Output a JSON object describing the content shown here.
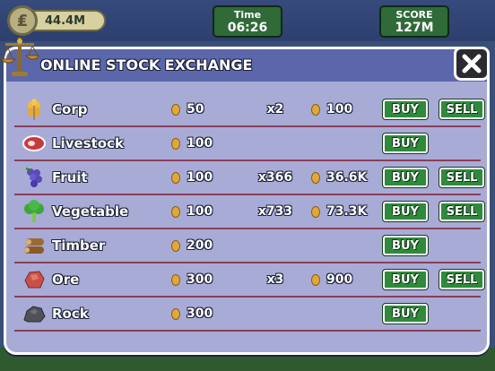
{
  "hud": {
    "money_value": "44.4M",
    "time_label": "Time",
    "time_value": "06:26",
    "score_label": "SCORE",
    "score_value": "127M",
    "coin_symbol": "₤"
  },
  "panel": {
    "title": "ONLINE STOCK EXCHANGE",
    "close_symbol": "✕"
  },
  "items": [
    {
      "name": "Corp",
      "icon": "wheat-icon",
      "price": "50",
      "qty": "x2",
      "total": "100",
      "buy": "BUY",
      "sell": "SELL"
    },
    {
      "name": "Livestock",
      "icon": "steak-icon",
      "price": "100",
      "qty": "",
      "total": "",
      "buy": "BUY",
      "sell": ""
    },
    {
      "name": "Fruit",
      "icon": "grapes-icon",
      "price": "100",
      "qty": "x366",
      "total": "36.6K",
      "buy": "BUY",
      "sell": "SELL"
    },
    {
      "name": "Vegetable",
      "icon": "broccoli-icon",
      "price": "100",
      "qty": "x733",
      "total": "73.3K",
      "buy": "BUY",
      "sell": "SELL"
    },
    {
      "name": "Timber",
      "icon": "logs-icon",
      "price": "200",
      "qty": "",
      "total": "",
      "buy": "BUY",
      "sell": ""
    },
    {
      "name": "Ore",
      "icon": "ore-icon",
      "price": "300",
      "qty": "x3",
      "total": "900",
      "buy": "BUY",
      "sell": "SELL"
    },
    {
      "name": "Rock",
      "icon": "rock-icon",
      "price": "300",
      "qty": "",
      "total": "",
      "buy": "BUY",
      "sell": ""
    }
  ],
  "colors": {
    "panel_bg": "#a8abd6",
    "header_bg": "#5c67ab",
    "button_green": "#2f8a3c",
    "row_divider": "#8a3e5a",
    "coin_gold": "#e0a838"
  }
}
